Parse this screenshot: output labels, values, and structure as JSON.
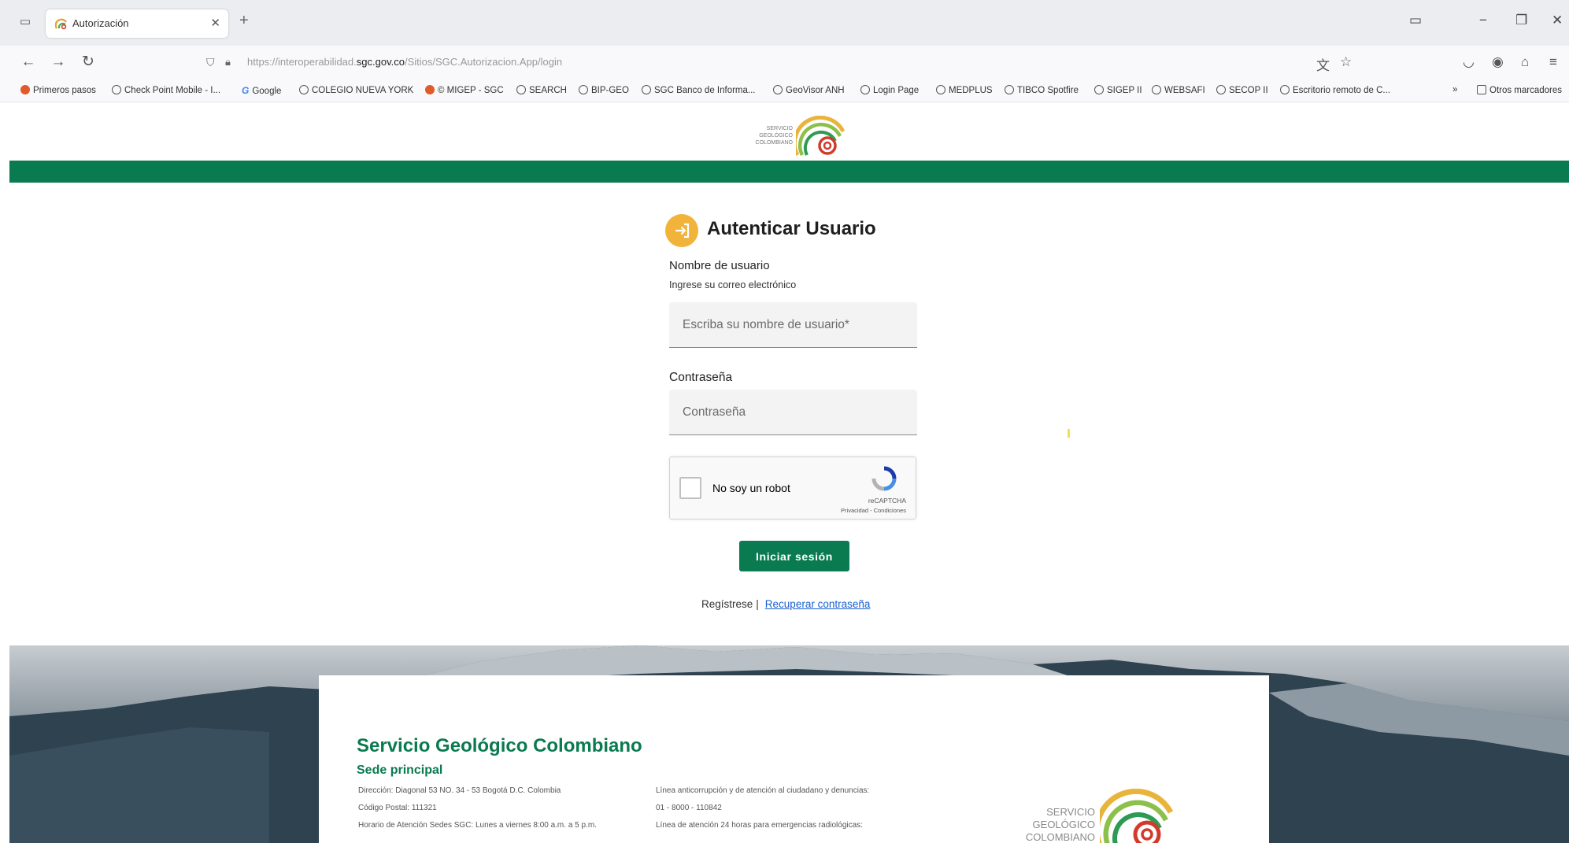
{
  "browser": {
    "tab_title": "Autorización",
    "url_prefix": "https://interoperabilidad.",
    "url_domain": "sgc.gov.co",
    "url_path": "/Sitios/SGC.Autorizacion.App/login"
  },
  "bookmarks": {
    "items": [
      "Primeros pasos",
      "Check Point Mobile - I...",
      "Google",
      "COLEGIO NUEVA YORK",
      "© MIGEP - SGC",
      "SEARCH",
      "BIP-GEO",
      "SGC Banco de Informa...",
      "GeoVisor ANH",
      "Login Page",
      "MEDPLUS",
      "TIBCO Spotfire",
      "SIGEP II",
      "WEBSAFI",
      "SECOP II",
      "Escritorio remoto de C..."
    ],
    "overflow": "»",
    "other": "Otros marcadores"
  },
  "logo": {
    "line1": "SERVICIO",
    "line2": "GEOLÓGICO",
    "line3": "COLOMBIANO"
  },
  "login": {
    "title": "Autenticar Usuario",
    "username_label": "Nombre de usuario",
    "username_hint": "Ingrese su correo electrónico",
    "username_placeholder": "Escriba su nombre de usuario*",
    "password_label": "Contraseña",
    "password_placeholder": "Contraseña",
    "captcha_label": "No soy un robot",
    "captcha_brand": "reCAPTCHA",
    "captcha_terms": "Privacidad - Condiciones",
    "submit": "Iniciar sesión",
    "register": "Regístrese",
    "separator": "|",
    "recover": "Recuperar contraseña"
  },
  "footer": {
    "title": "Servicio Geológico Colombiano",
    "subtitle": "Sede principal",
    "col1": [
      "Dirección: Diagonal 53 NO. 34 - 53 Bogotá D.C. Colombia",
      "Código Postal: 111321",
      "Horario de Atención Sedes SGC: Lunes a viernes 8:00 a.m. a 5 p.m."
    ],
    "col2": [
      "Línea anticorrupción y de atención al ciudadano y denuncias:",
      "01 - 8000 - 110842",
      "Línea de atención 24 horas para emergencias radiológicas:"
    ]
  },
  "colors": {
    "brand_green": "#0a7a50",
    "login_icon": "#f2b33a",
    "link_blue": "#1a5fd1"
  }
}
